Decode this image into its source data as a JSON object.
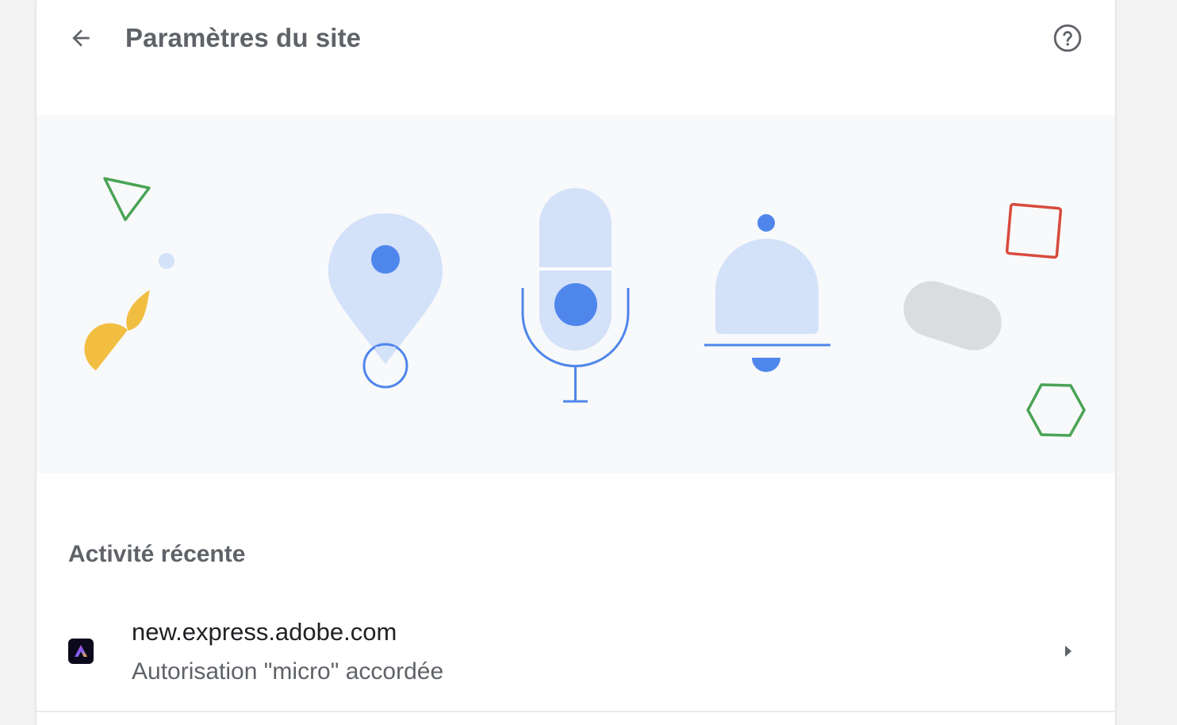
{
  "header": {
    "title": "Paramètres du site",
    "back_icon": "arrow-back-icon",
    "help_icon": "help-circle-icon"
  },
  "banner": {
    "icons": [
      "location-pin-icon",
      "microphone-icon",
      "notification-bell-icon"
    ],
    "decorations": [
      "green-triangle",
      "light-blue-dot",
      "yellow-half-circle",
      "red-square",
      "gray-pill",
      "green-hexagon"
    ]
  },
  "recent_activity": {
    "heading": "Activité récente",
    "items": [
      {
        "site": "new.express.adobe.com",
        "status": "Autorisation \"micro\" accordée",
        "favicon_icon": "adobe-express-icon",
        "chevron_icon": "chevron-right-icon"
      }
    ]
  },
  "colors": {
    "accent": "#4f86ec",
    "accent_light": "#d3e1f9",
    "text_primary": "#202124",
    "text_secondary": "#5f6368",
    "banner_bg": "#f8f9fa",
    "green": "#4aa456",
    "yellow": "#f2be42",
    "red": "#d84a3d",
    "gray": "#dadce0"
  }
}
